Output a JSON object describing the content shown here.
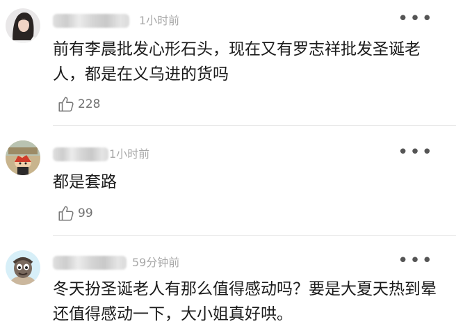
{
  "comments": [
    {
      "time": "1小时前",
      "text": "前有李晨批发心形石头，现在又有罗志祥批发圣诞老人，都是在义乌进的货吗",
      "likes": "228",
      "more_icon": "more-dots-icon"
    },
    {
      "time": "1小时前",
      "text": "都是套路",
      "likes": "99",
      "more_icon": "more-dots-icon"
    },
    {
      "time": "59分钟前",
      "text": "冬天扮圣诞老人有那么值得感动吗？要是大夏天热到晕还值得感动一下，大小姐真好哄。",
      "more_icon": "more-dots-icon"
    }
  ],
  "icons": {
    "like": "thumbs-up-icon",
    "more": "more-dots-icon"
  }
}
